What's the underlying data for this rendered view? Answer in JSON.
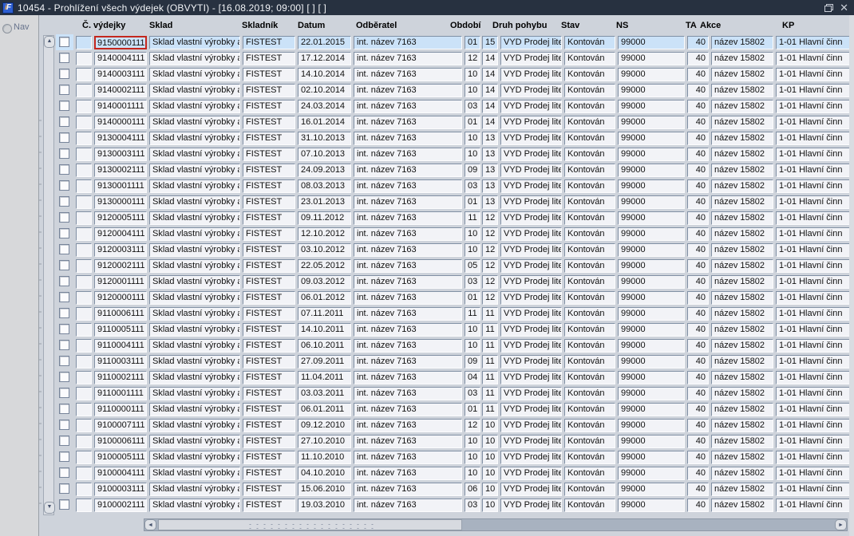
{
  "titlebar": {
    "title": "10454 - Prohlížení všech výdejek (OBVYTI) - [16.08.2019; 09:00]  [ ]  [ ]",
    "app_icon_text": "F"
  },
  "nav": {
    "label": "Nav"
  },
  "table": {
    "headers": [
      "Č. výdejky",
      "Sklad",
      "Skladník",
      "Datum",
      "Odběratel",
      "Období",
      "Druh pohybu",
      "Stav",
      "NS",
      "TA",
      "Akce",
      "KP"
    ],
    "focus": {
      "row": 0,
      "column": "cislo"
    },
    "rows": [
      {
        "cislo": "9150000111",
        "sklad": "Sklad vlastní výrobky a",
        "skladnik": "FISTEST",
        "datum": "22.01.2015",
        "odberatel": "int. název 7163",
        "obdobi_mesic": "01",
        "obdobi_rok": "15",
        "druh_pohybu": "VYD Prodej liter.",
        "stav": "Kontován",
        "ns": "99000",
        "ta": "40",
        "akce": "název 15802",
        "kp": "1-01 Hlavní činn"
      },
      {
        "cislo": "9140004111",
        "sklad": "Sklad vlastní výrobky a",
        "skladnik": "FISTEST",
        "datum": "17.12.2014",
        "odberatel": "int. název 7163",
        "obdobi_mesic": "12",
        "obdobi_rok": "14",
        "druh_pohybu": "VYD Prodej liter.",
        "stav": "Kontován",
        "ns": "99000",
        "ta": "40",
        "akce": "název 15802",
        "kp": "1-01 Hlavní činn"
      },
      {
        "cislo": "9140003111",
        "sklad": "Sklad vlastní výrobky a",
        "skladnik": "FISTEST",
        "datum": "14.10.2014",
        "odberatel": "int. název 7163",
        "obdobi_mesic": "10",
        "obdobi_rok": "14",
        "druh_pohybu": "VYD Prodej liter.",
        "stav": "Kontován",
        "ns": "99000",
        "ta": "40",
        "akce": "název 15802",
        "kp": "1-01 Hlavní činn"
      },
      {
        "cislo": "9140002111",
        "sklad": "Sklad vlastní výrobky a",
        "skladnik": "FISTEST",
        "datum": "02.10.2014",
        "odberatel": "int. název 7163",
        "obdobi_mesic": "10",
        "obdobi_rok": "14",
        "druh_pohybu": "VYD Prodej liter.",
        "stav": "Kontován",
        "ns": "99000",
        "ta": "40",
        "akce": "název 15802",
        "kp": "1-01 Hlavní činn"
      },
      {
        "cislo": "9140001111",
        "sklad": "Sklad vlastní výrobky a",
        "skladnik": "FISTEST",
        "datum": "24.03.2014",
        "odberatel": "int. název 7163",
        "obdobi_mesic": "03",
        "obdobi_rok": "14",
        "druh_pohybu": "VYD Prodej liter.",
        "stav": "Kontován",
        "ns": "99000",
        "ta": "40",
        "akce": "název 15802",
        "kp": "1-01 Hlavní činn"
      },
      {
        "cislo": "9140000111",
        "sklad": "Sklad vlastní výrobky a",
        "skladnik": "FISTEST",
        "datum": "16.01.2014",
        "odberatel": "int. název 7163",
        "obdobi_mesic": "01",
        "obdobi_rok": "14",
        "druh_pohybu": "VYD Prodej liter.",
        "stav": "Kontován",
        "ns": "99000",
        "ta": "40",
        "akce": "název 15802",
        "kp": "1-01 Hlavní činn"
      },
      {
        "cislo": "9130004111",
        "sklad": "Sklad vlastní výrobky a",
        "skladnik": "FISTEST",
        "datum": "31.10.2013",
        "odberatel": "int. název 7163",
        "obdobi_mesic": "10",
        "obdobi_rok": "13",
        "druh_pohybu": "VYD Prodej liter.",
        "stav": "Kontován",
        "ns": "99000",
        "ta": "40",
        "akce": "název 15802",
        "kp": "1-01 Hlavní činn"
      },
      {
        "cislo": "9130003111",
        "sklad": "Sklad vlastní výrobky a",
        "skladnik": "FISTEST",
        "datum": "07.10.2013",
        "odberatel": "int. název 7163",
        "obdobi_mesic": "10",
        "obdobi_rok": "13",
        "druh_pohybu": "VYD Prodej liter.",
        "stav": "Kontován",
        "ns": "99000",
        "ta": "40",
        "akce": "název 15802",
        "kp": "1-01 Hlavní činn"
      },
      {
        "cislo": "9130002111",
        "sklad": "Sklad vlastní výrobky a",
        "skladnik": "FISTEST",
        "datum": "24.09.2013",
        "odberatel": "int. název 7163",
        "obdobi_mesic": "09",
        "obdobi_rok": "13",
        "druh_pohybu": "VYD Prodej liter.",
        "stav": "Kontován",
        "ns": "99000",
        "ta": "40",
        "akce": "název 15802",
        "kp": "1-01 Hlavní činn"
      },
      {
        "cislo": "9130001111",
        "sklad": "Sklad vlastní výrobky a",
        "skladnik": "FISTEST",
        "datum": "08.03.2013",
        "odberatel": "int. název 7163",
        "obdobi_mesic": "03",
        "obdobi_rok": "13",
        "druh_pohybu": "VYD Prodej liter.",
        "stav": "Kontován",
        "ns": "99000",
        "ta": "40",
        "akce": "název 15802",
        "kp": "1-01 Hlavní činn"
      },
      {
        "cislo": "9130000111",
        "sklad": "Sklad vlastní výrobky a",
        "skladnik": "FISTEST",
        "datum": "23.01.2013",
        "odberatel": "int. název 7163",
        "obdobi_mesic": "01",
        "obdobi_rok": "13",
        "druh_pohybu": "VYD Prodej liter.",
        "stav": "Kontován",
        "ns": "99000",
        "ta": "40",
        "akce": "název 15802",
        "kp": "1-01 Hlavní činn"
      },
      {
        "cislo": "9120005111",
        "sklad": "Sklad vlastní výrobky a",
        "skladnik": "FISTEST",
        "datum": "09.11.2012",
        "odberatel": "int. název 7163",
        "obdobi_mesic": "11",
        "obdobi_rok": "12",
        "druh_pohybu": "VYD Prodej liter.",
        "stav": "Kontován",
        "ns": "99000",
        "ta": "40",
        "akce": "název 15802",
        "kp": "1-01 Hlavní činn"
      },
      {
        "cislo": "9120004111",
        "sklad": "Sklad vlastní výrobky a",
        "skladnik": "FISTEST",
        "datum": "12.10.2012",
        "odberatel": "int. název 7163",
        "obdobi_mesic": "10",
        "obdobi_rok": "12",
        "druh_pohybu": "VYD Prodej liter.",
        "stav": "Kontován",
        "ns": "99000",
        "ta": "40",
        "akce": "název 15802",
        "kp": "1-01 Hlavní činn"
      },
      {
        "cislo": "9120003111",
        "sklad": "Sklad vlastní výrobky a",
        "skladnik": "FISTEST",
        "datum": "03.10.2012",
        "odberatel": "int. název 7163",
        "obdobi_mesic": "10",
        "obdobi_rok": "12",
        "druh_pohybu": "VYD Prodej liter.",
        "stav": "Kontován",
        "ns": "99000",
        "ta": "40",
        "akce": "název 15802",
        "kp": "1-01 Hlavní činn"
      },
      {
        "cislo": "9120002111",
        "sklad": "Sklad vlastní výrobky a",
        "skladnik": "FISTEST",
        "datum": "22.05.2012",
        "odberatel": "int. název 7163",
        "obdobi_mesic": "05",
        "obdobi_rok": "12",
        "druh_pohybu": "VYD Prodej liter.",
        "stav": "Kontován",
        "ns": "99000",
        "ta": "40",
        "akce": "název 15802",
        "kp": "1-01 Hlavní činn"
      },
      {
        "cislo": "9120001111",
        "sklad": "Sklad vlastní výrobky a",
        "skladnik": "FISTEST",
        "datum": "09.03.2012",
        "odberatel": "int. název 7163",
        "obdobi_mesic": "03",
        "obdobi_rok": "12",
        "druh_pohybu": "VYD Prodej liter.",
        "stav": "Kontován",
        "ns": "99000",
        "ta": "40",
        "akce": "název 15802",
        "kp": "1-01 Hlavní činn"
      },
      {
        "cislo": "9120000111",
        "sklad": "Sklad vlastní výrobky a",
        "skladnik": "FISTEST",
        "datum": "06.01.2012",
        "odberatel": "int. název 7163",
        "obdobi_mesic": "01",
        "obdobi_rok": "12",
        "druh_pohybu": "VYD Prodej liter.",
        "stav": "Kontován",
        "ns": "99000",
        "ta": "40",
        "akce": "název 15802",
        "kp": "1-01 Hlavní činn"
      },
      {
        "cislo": "9110006111",
        "sklad": "Sklad vlastní výrobky a",
        "skladnik": "FISTEST",
        "datum": "07.11.2011",
        "odberatel": "int. název 7163",
        "obdobi_mesic": "11",
        "obdobi_rok": "11",
        "druh_pohybu": "VYD Prodej liter.",
        "stav": "Kontován",
        "ns": "99000",
        "ta": "40",
        "akce": "název 15802",
        "kp": "1-01 Hlavní činn"
      },
      {
        "cislo": "9110005111",
        "sklad": "Sklad vlastní výrobky a",
        "skladnik": "FISTEST",
        "datum": "14.10.2011",
        "odberatel": "int. název 7163",
        "obdobi_mesic": "10",
        "obdobi_rok": "11",
        "druh_pohybu": "VYD Prodej liter.",
        "stav": "Kontován",
        "ns": "99000",
        "ta": "40",
        "akce": "název 15802",
        "kp": "1-01 Hlavní činn"
      },
      {
        "cislo": "9110004111",
        "sklad": "Sklad vlastní výrobky a",
        "skladnik": "FISTEST",
        "datum": "06.10.2011",
        "odberatel": "int. název 7163",
        "obdobi_mesic": "10",
        "obdobi_rok": "11",
        "druh_pohybu": "VYD Prodej liter.",
        "stav": "Kontován",
        "ns": "99000",
        "ta": "40",
        "akce": "název 15802",
        "kp": "1-01 Hlavní činn"
      },
      {
        "cislo": "9110003111",
        "sklad": "Sklad vlastní výrobky a",
        "skladnik": "FISTEST",
        "datum": "27.09.2011",
        "odberatel": "int. název 7163",
        "obdobi_mesic": "09",
        "obdobi_rok": "11",
        "druh_pohybu": "VYD Prodej liter.",
        "stav": "Kontován",
        "ns": "99000",
        "ta": "40",
        "akce": "název 15802",
        "kp": "1-01 Hlavní činn"
      },
      {
        "cislo": "9110002111",
        "sklad": "Sklad vlastní výrobky a",
        "skladnik": "FISTEST",
        "datum": "11.04.2011",
        "odberatel": "int. název 7163",
        "obdobi_mesic": "04",
        "obdobi_rok": "11",
        "druh_pohybu": "VYD Prodej liter.",
        "stav": "Kontován",
        "ns": "99000",
        "ta": "40",
        "akce": "název 15802",
        "kp": "1-01 Hlavní činn"
      },
      {
        "cislo": "9110001111",
        "sklad": "Sklad vlastní výrobky a",
        "skladnik": "FISTEST",
        "datum": "03.03.2011",
        "odberatel": "int. název 7163",
        "obdobi_mesic": "03",
        "obdobi_rok": "11",
        "druh_pohybu": "VYD Prodej liter.",
        "stav": "Kontován",
        "ns": "99000",
        "ta": "40",
        "akce": "název 15802",
        "kp": "1-01 Hlavní činn"
      },
      {
        "cislo": "9110000111",
        "sklad": "Sklad vlastní výrobky a",
        "skladnik": "FISTEST",
        "datum": "06.01.2011",
        "odberatel": "int. název 7163",
        "obdobi_mesic": "01",
        "obdobi_rok": "11",
        "druh_pohybu": "VYD Prodej liter.",
        "stav": "Kontován",
        "ns": "99000",
        "ta": "40",
        "akce": "název 15802",
        "kp": "1-01 Hlavní činn"
      },
      {
        "cislo": "9100007111",
        "sklad": "Sklad vlastní výrobky a",
        "skladnik": "FISTEST",
        "datum": "09.12.2010",
        "odberatel": "int. název 7163",
        "obdobi_mesic": "12",
        "obdobi_rok": "10",
        "druh_pohybu": "VYD Prodej liter.",
        "stav": "Kontován",
        "ns": "99000",
        "ta": "40",
        "akce": "název 15802",
        "kp": "1-01 Hlavní činn"
      },
      {
        "cislo": "9100006111",
        "sklad": "Sklad vlastní výrobky a",
        "skladnik": "FISTEST",
        "datum": "27.10.2010",
        "odberatel": "int. název 7163",
        "obdobi_mesic": "10",
        "obdobi_rok": "10",
        "druh_pohybu": "VYD Prodej liter.",
        "stav": "Kontován",
        "ns": "99000",
        "ta": "40",
        "akce": "název 15802",
        "kp": "1-01 Hlavní činn"
      },
      {
        "cislo": "9100005111",
        "sklad": "Sklad vlastní výrobky a",
        "skladnik": "FISTEST",
        "datum": "11.10.2010",
        "odberatel": "int. název 7163",
        "obdobi_mesic": "10",
        "obdobi_rok": "10",
        "druh_pohybu": "VYD Prodej liter.",
        "stav": "Kontován",
        "ns": "99000",
        "ta": "40",
        "akce": "název 15802",
        "kp": "1-01 Hlavní činn"
      },
      {
        "cislo": "9100004111",
        "sklad": "Sklad vlastní výrobky a",
        "skladnik": "FISTEST",
        "datum": "04.10.2010",
        "odberatel": "int. název 7163",
        "obdobi_mesic": "10",
        "obdobi_rok": "10",
        "druh_pohybu": "VYD Prodej liter.",
        "stav": "Kontován",
        "ns": "99000",
        "ta": "40",
        "akce": "název 15802",
        "kp": "1-01 Hlavní činn"
      },
      {
        "cislo": "9100003111",
        "sklad": "Sklad vlastní výrobky a",
        "skladnik": "FISTEST",
        "datum": "15.06.2010",
        "odberatel": "int. název 7163",
        "obdobi_mesic": "06",
        "obdobi_rok": "10",
        "druh_pohybu": "VYD Prodej liter.",
        "stav": "Kontován",
        "ns": "99000",
        "ta": "40",
        "akce": "název 15802",
        "kp": "1-01 Hlavní činn"
      },
      {
        "cislo": "9100002111",
        "sklad": "Sklad vlastní výrobky a",
        "skladnik": "FISTEST",
        "datum": "19.03.2010",
        "odberatel": "int. název 7163",
        "obdobi_mesic": "03",
        "obdobi_rok": "10",
        "druh_pohybu": "VYD Prodej liter.",
        "stav": "Kontován",
        "ns": "99000",
        "ta": "40",
        "akce": "název 15802",
        "kp": "1-01 Hlavní činn"
      }
    ]
  }
}
